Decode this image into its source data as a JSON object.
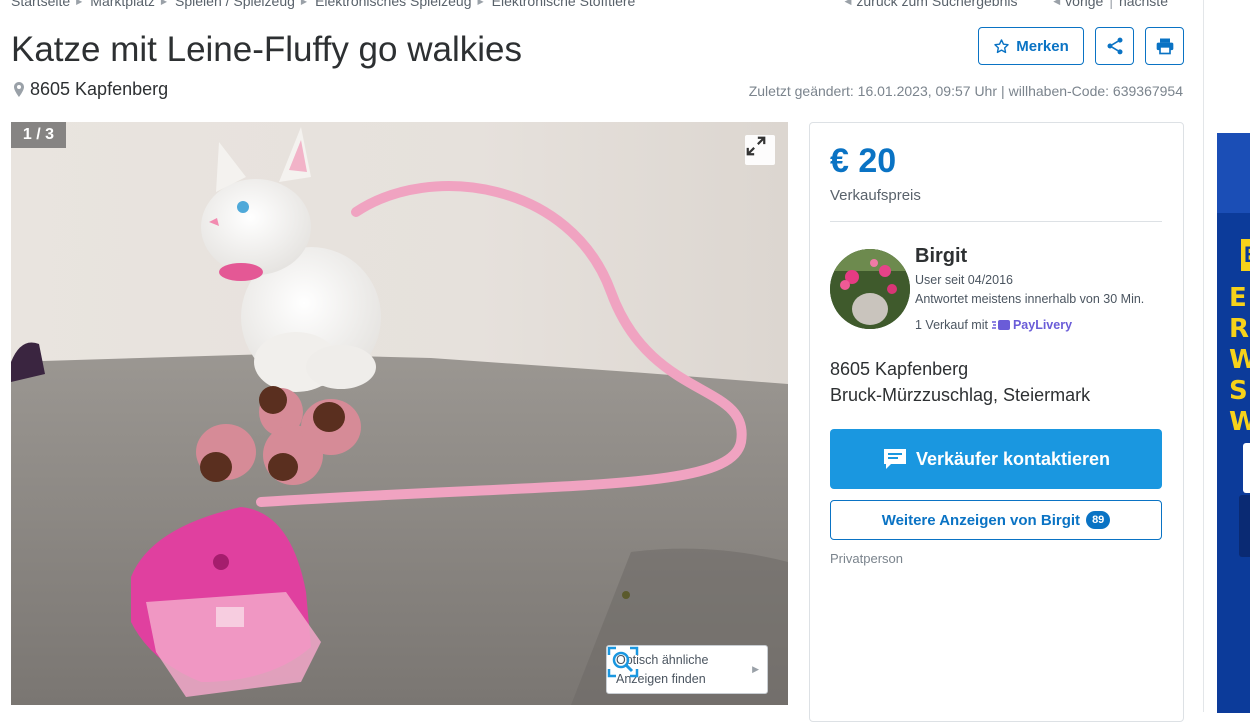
{
  "breadcrumb": [
    "Startseite",
    "Marktplatz",
    "Spielen / Spielzeug",
    "Elektronisches Spielzeug",
    "Elektronische Stofftiere"
  ],
  "nav": {
    "back": "zurück zum Suchergebnis",
    "prev": "vorige",
    "next": "nächste"
  },
  "listing": {
    "title": "Katze mit Leine-Fluffy go walkies",
    "location": "8605 Kapfenberg",
    "last_changed": "Zuletzt geändert: 16.01.2023, 09:57 Uhr",
    "code": "willhaben-Code: 639367954"
  },
  "toolbar": {
    "save_label": "Merken"
  },
  "gallery": {
    "counter": "1 / 3",
    "similar_line1": "Optisch ähnliche",
    "similar_line2": "Anzeigen finden"
  },
  "price": {
    "value": "€ 20",
    "label": "Verkaufspreis"
  },
  "seller": {
    "name": "Birgit",
    "since": "User seit 04/2016",
    "response": "Antwortet meistens innerhalb von 30 Min.",
    "sales_prefix": "1 Verkauf mit",
    "payment_brand": "PayLivery",
    "address_line1": "8605 Kapfenberg",
    "address_line2": "Bruck-Mürzzuschlag, Steiermark",
    "type": "Privatperson"
  },
  "actions": {
    "contact_label": "Verkäufer kontaktieren",
    "more_ads_label": "Weitere Anzeigen von Birgit",
    "more_ads_count": "89"
  },
  "ad": {
    "yellow_letter": "B",
    "letters": [
      "E",
      "R",
      "W",
      "S",
      "W"
    ]
  },
  "colors": {
    "brand_blue": "#0a73c4",
    "cta_blue": "#1a97e0",
    "paylivery": "#6a5cd8",
    "ad_yellow": "#f7d21a"
  }
}
